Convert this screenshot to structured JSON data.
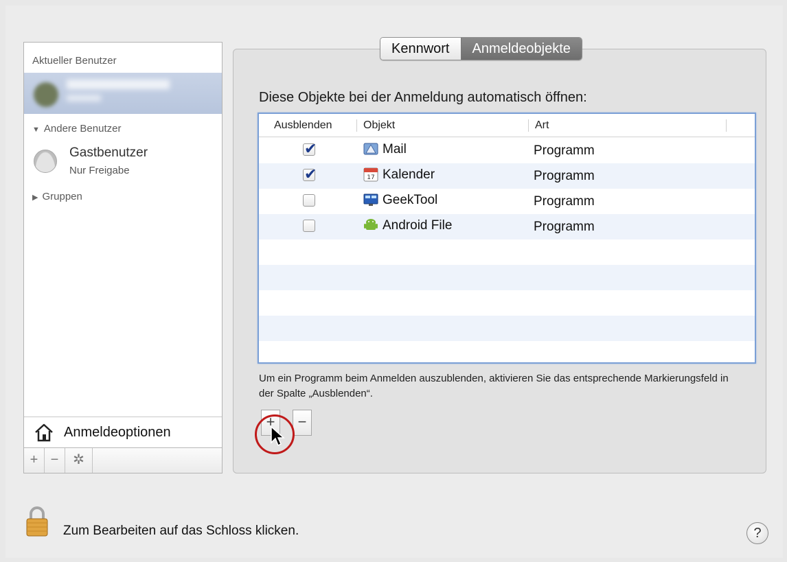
{
  "sidebar": {
    "current_user_heading": "Aktueller Benutzer",
    "other_users_heading": "Andere Benutzer",
    "guest_name": "Gastbenutzer",
    "guest_sub": "Nur Freigabe",
    "groups_heading": "Gruppen",
    "login_options_label": "Anmeldeoptionen",
    "toolbar": {
      "add": "+",
      "remove": "−",
      "action": "✲"
    }
  },
  "tabs": [
    {
      "label": "Kennwort",
      "active": false
    },
    {
      "label": "Anmeldeobjekte",
      "active": true
    }
  ],
  "main": {
    "intro": "Diese Objekte bei der Anmeldung automatisch öffnen:",
    "columns": {
      "hide": "Ausblenden",
      "object": "Objekt",
      "type": "Art"
    },
    "items": [
      {
        "hidden": true,
        "name": "Mail",
        "type": "Programm",
        "icon": "mail-icon"
      },
      {
        "hidden": true,
        "name": "Kalender",
        "type": "Programm",
        "icon": "calendar-icon"
      },
      {
        "hidden": false,
        "name": "GeekTool",
        "type": "Programm",
        "icon": "geektool-icon"
      },
      {
        "hidden": false,
        "name": "Android File",
        "type": "Programm",
        "icon": "android-file-icon"
      }
    ],
    "hint": "Um ein Programm beim Anmelden auszublenden, aktivieren Sie das entsprechende Markierungsfeld in der Spalte „Ausblenden“.",
    "add_button": "+",
    "remove_button": "−"
  },
  "footer": {
    "lock_text": "Zum Bearbeiten auf das Schloss klicken.",
    "help": "?"
  },
  "colors": {
    "highlight_circle": "#c01a1a",
    "selection": "#b7c5dd",
    "table_focus": "#7ba0d6"
  }
}
